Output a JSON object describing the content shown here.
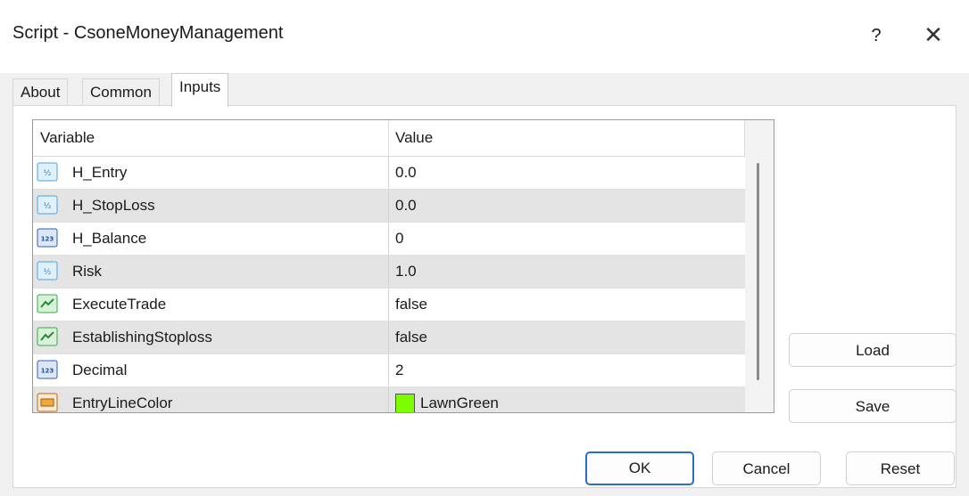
{
  "window": {
    "title": "Script - CsoneMoneyManagement",
    "help_label": "?",
    "close_label": "✕"
  },
  "tabs": [
    {
      "label": "About"
    },
    {
      "label": "Common"
    },
    {
      "label": "Inputs"
    }
  ],
  "active_tab": "Inputs",
  "grid": {
    "columns": [
      "Variable",
      "Value"
    ],
    "rows": [
      {
        "name": "H_Entry",
        "value": "0.0",
        "icon": "double-icon"
      },
      {
        "name": "H_StopLoss",
        "value": "0.0",
        "icon": "double-icon"
      },
      {
        "name": "H_Balance",
        "value": "0",
        "icon": "integer-icon"
      },
      {
        "name": "Risk",
        "value": "1.0",
        "icon": "double-icon"
      },
      {
        "name": "ExecuteTrade",
        "value": "false",
        "icon": "bool-icon"
      },
      {
        "name": "EstablishingStoploss",
        "value": "false",
        "icon": "bool-icon"
      },
      {
        "name": "Decimal",
        "value": "2",
        "icon": "integer-icon"
      },
      {
        "name": "EntryLineColor",
        "value": "LawnGreen",
        "icon": "color-icon",
        "swatch": "#7cfc00"
      }
    ]
  },
  "side_buttons": {
    "load": "Load",
    "save": "Save"
  },
  "footer_buttons": {
    "ok": "OK",
    "cancel": "Cancel",
    "reset": "Reset"
  },
  "colors": {
    "accent": "#2a6ccf",
    "double_icon": "#4aa3df",
    "integer_icon": "#2f5fa8",
    "bool_icon": "#3aa84a"
  }
}
